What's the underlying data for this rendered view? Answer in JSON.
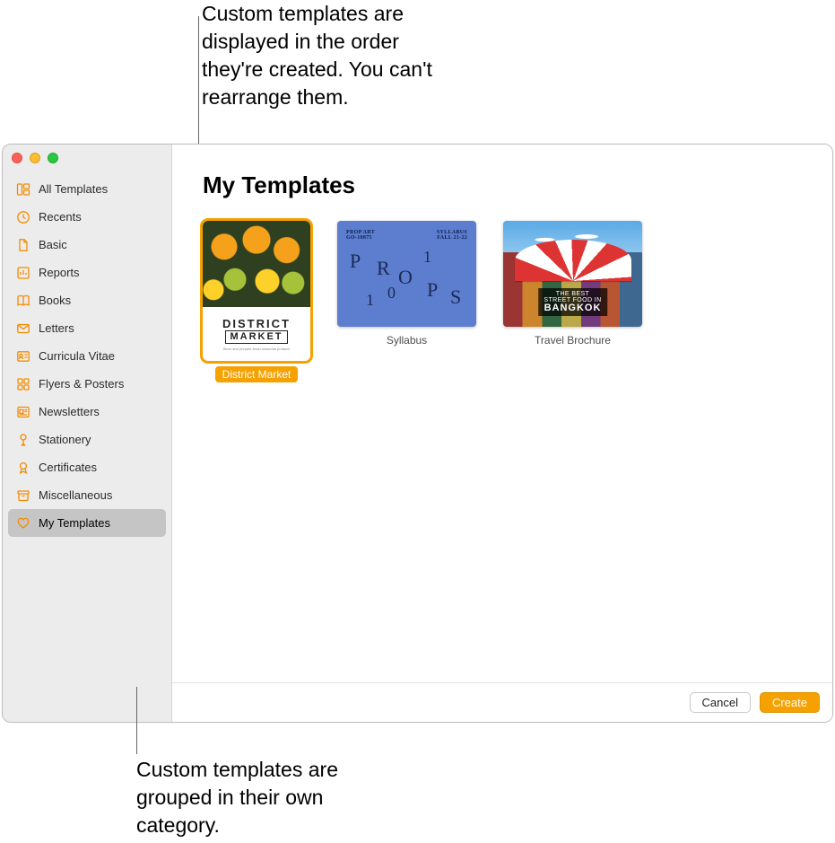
{
  "callouts": {
    "top": "Custom templates are displayed in the order they're created. You can't rearrange them.",
    "bottom": "Custom templates are grouped in their own category."
  },
  "sidebar": {
    "items": [
      {
        "label": "All Templates",
        "icon": "templates-icon"
      },
      {
        "label": "Recents",
        "icon": "clock-icon"
      },
      {
        "label": "Basic",
        "icon": "document-icon"
      },
      {
        "label": "Reports",
        "icon": "chart-icon"
      },
      {
        "label": "Books",
        "icon": "book-icon"
      },
      {
        "label": "Letters",
        "icon": "envelope-icon"
      },
      {
        "label": "Curricula Vitae",
        "icon": "person-card-icon"
      },
      {
        "label": "Flyers & Posters",
        "icon": "grid-icon"
      },
      {
        "label": "Newsletters",
        "icon": "newspaper-icon"
      },
      {
        "label": "Stationery",
        "icon": "pencil-icon"
      },
      {
        "label": "Certificates",
        "icon": "ribbon-icon"
      },
      {
        "label": "Miscellaneous",
        "icon": "archive-icon"
      },
      {
        "label": "My Templates",
        "icon": "heart-icon",
        "selected": true
      }
    ]
  },
  "main": {
    "title": "My Templates",
    "templates": [
      {
        "name": "District Market",
        "selected": true,
        "orientation": "portrait",
        "thumb": {
          "kind": "market",
          "line1": "DISTRICT",
          "line2": "MARKET",
          "sub": "Store and prepare fresh seasonal produce"
        }
      },
      {
        "name": "Syllabus",
        "selected": false,
        "orientation": "landscape",
        "thumb": {
          "kind": "syllabus",
          "hdr_left": "PROP ART\nGO-10875",
          "hdr_right": "SYLLABUS\nFALL 21-22",
          "word": "PROPS",
          "digits": "101"
        }
      },
      {
        "name": "Travel Brochure",
        "selected": false,
        "orientation": "landscape",
        "thumb": {
          "kind": "travel",
          "label_top": "THE BEST STREET FOOD IN",
          "label_main": "BANGKOK"
        }
      }
    ]
  },
  "footer": {
    "cancel": "Cancel",
    "create": "Create"
  },
  "colors": {
    "accent": "#f5a100"
  }
}
